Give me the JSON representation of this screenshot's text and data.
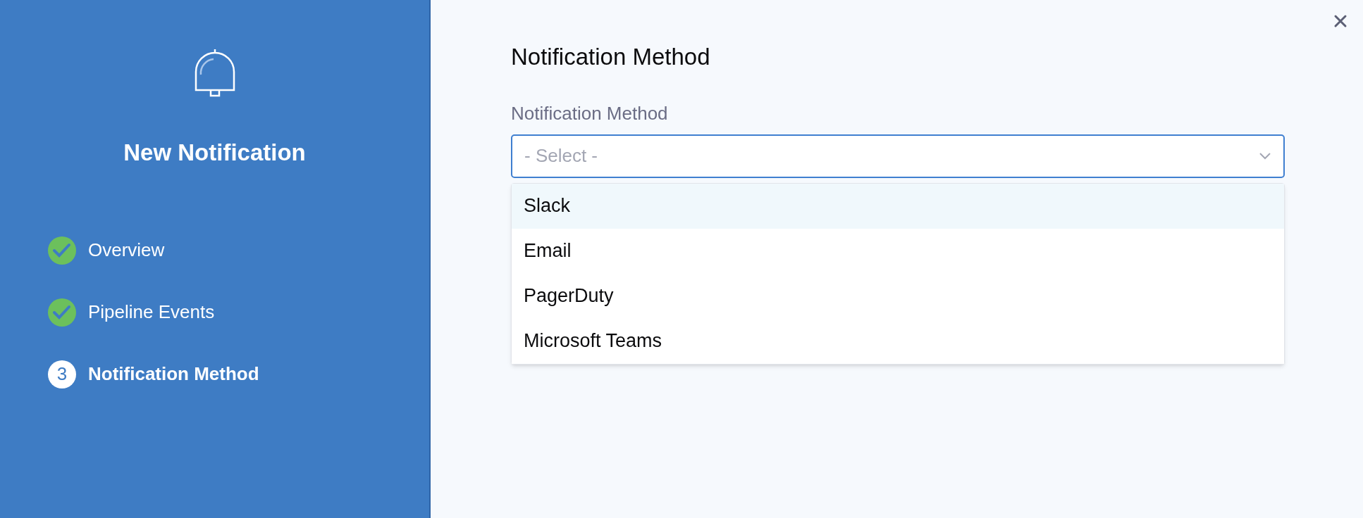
{
  "sidebar": {
    "title": "New Notification",
    "steps": [
      {
        "label": "Overview",
        "completed": true,
        "current": false
      },
      {
        "label": "Pipeline Events",
        "completed": true,
        "current": false
      },
      {
        "label": "Notification Method",
        "completed": false,
        "current": true,
        "number": "3"
      }
    ]
  },
  "main": {
    "heading": "Notification Method",
    "field": {
      "label": "Notification Method",
      "placeholder": "- Select -",
      "expanded": true
    },
    "options": [
      {
        "label": "Slack",
        "selected": true
      },
      {
        "label": "Email",
        "selected": false
      },
      {
        "label": "PagerDuty",
        "selected": false
      },
      {
        "label": "Microsoft Teams",
        "selected": false
      }
    ]
  }
}
